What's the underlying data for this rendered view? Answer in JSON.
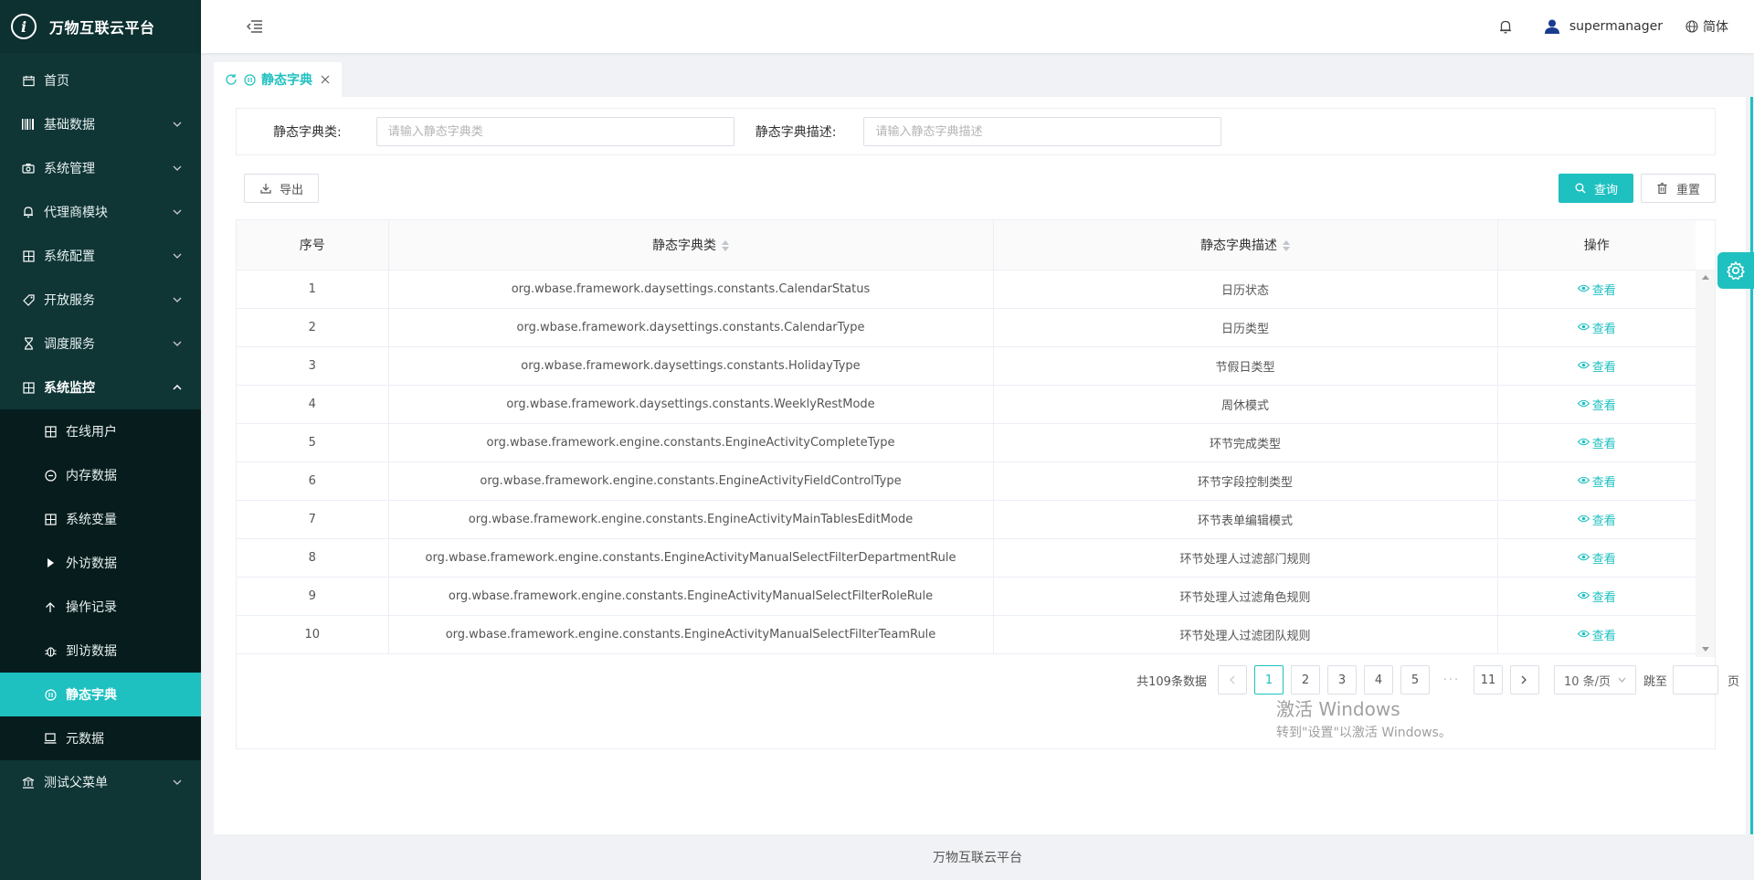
{
  "app": {
    "title": "万物互联云平台"
  },
  "colors": {
    "accent": "#1fc0c0",
    "sidebar_bg": "#0f3535",
    "submenu_bg": "#071d1d"
  },
  "sidebar": {
    "items": [
      {
        "label": "首页",
        "icon": "calendar-icon"
      },
      {
        "label": "基础数据",
        "icon": "barcode-icon"
      },
      {
        "label": "系统管理",
        "icon": "camera-icon"
      },
      {
        "label": "代理商模块",
        "icon": "bell-icon"
      },
      {
        "label": "系统配置",
        "icon": "grid-icon"
      },
      {
        "label": "开放服务",
        "icon": "tag-icon"
      },
      {
        "label": "调度服务",
        "icon": "hourglass-icon"
      },
      {
        "label": "系统监控",
        "icon": "grid-icon"
      }
    ],
    "monitor_sub": [
      {
        "label": "在线用户",
        "icon": "grid-icon"
      },
      {
        "label": "内存数据",
        "icon": "circle-icon"
      },
      {
        "label": "系统变量",
        "icon": "grid-icon"
      },
      {
        "label": "外访数据",
        "icon": "play-icon"
      },
      {
        "label": "操作记录",
        "icon": "arrow-up-icon"
      },
      {
        "label": "到访数据",
        "icon": "bug-icon"
      },
      {
        "label": "静态字典",
        "icon": "circle-icon"
      },
      {
        "label": "元数据",
        "icon": "laptop-icon"
      }
    ],
    "last_item": {
      "label": "测试父菜单",
      "icon": "bank-icon"
    }
  },
  "header": {
    "username": "supermanager",
    "language": "简体"
  },
  "tabs": [
    {
      "label": "静态字典"
    }
  ],
  "search": {
    "class_label": "静态字典类:",
    "class_placeholder": "请输入静态字典类",
    "desc_label": "静态字典描述:",
    "desc_placeholder": "请输入静态字典描述"
  },
  "toolbar": {
    "export_label": "导出",
    "query_label": "查询",
    "reset_label": "重置"
  },
  "table": {
    "columns": [
      "序号",
      "静态字典类",
      "静态字典描述",
      "操作"
    ],
    "action_label": "查看",
    "rows": [
      {
        "no": "1",
        "cls": "org.wbase.framework.daysettings.constants.CalendarStatus",
        "desc": "日历状态"
      },
      {
        "no": "2",
        "cls": "org.wbase.framework.daysettings.constants.CalendarType",
        "desc": "日历类型"
      },
      {
        "no": "3",
        "cls": "org.wbase.framework.daysettings.constants.HolidayType",
        "desc": "节假日类型"
      },
      {
        "no": "4",
        "cls": "org.wbase.framework.daysettings.constants.WeeklyRestMode",
        "desc": "周休模式"
      },
      {
        "no": "5",
        "cls": "org.wbase.framework.engine.constants.EngineActivityCompleteType",
        "desc": "环节完成类型"
      },
      {
        "no": "6",
        "cls": "org.wbase.framework.engine.constants.EngineActivityFieldControlType",
        "desc": "环节字段控制类型"
      },
      {
        "no": "7",
        "cls": "org.wbase.framework.engine.constants.EngineActivityMainTablesEditMode",
        "desc": "环节表单编辑模式"
      },
      {
        "no": "8",
        "cls": "org.wbase.framework.engine.constants.EngineActivityManualSelectFilterDepartmentRule",
        "desc": "环节处理人过滤部门规则"
      },
      {
        "no": "9",
        "cls": "org.wbase.framework.engine.constants.EngineActivityManualSelectFilterRoleRule",
        "desc": "环节处理人过滤角色规则"
      },
      {
        "no": "10",
        "cls": "org.wbase.framework.engine.constants.EngineActivityManualSelectFilterTeamRule",
        "desc": "环节处理人过滤团队规则"
      }
    ]
  },
  "pagination": {
    "total": "共109条数据",
    "pages": [
      "1",
      "2",
      "3",
      "4",
      "5"
    ],
    "ellipsis": "···",
    "last_page": "11",
    "page_size": "10 条/页",
    "jump_label": "跳至",
    "page_suffix": "页"
  },
  "watermark": {
    "line1": "激活 Windows",
    "line2": "转到\"设置\"以激活 Windows。"
  },
  "footer": {
    "text": "万物互联云平台"
  }
}
